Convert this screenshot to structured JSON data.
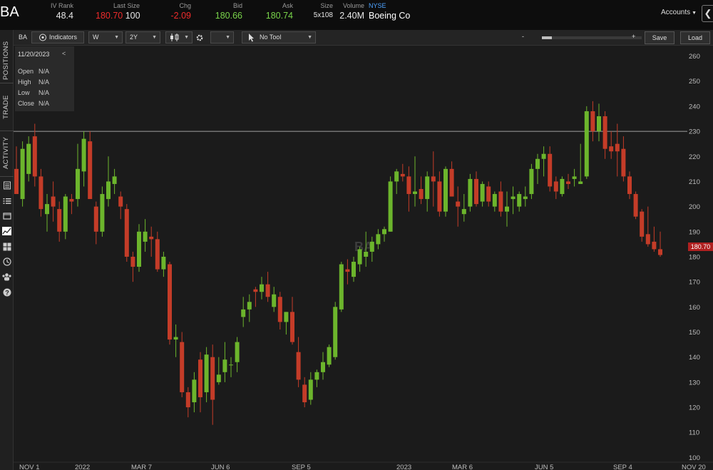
{
  "header": {
    "symbol": "BA",
    "iv_rank": {
      "label": "IV Rank",
      "value": "48.4"
    },
    "last_size": {
      "label": "Last Size",
      "last": "180.70",
      "size": "100"
    },
    "chg": {
      "label": "Chg",
      "value": "-2.09"
    },
    "bid": {
      "label": "Bid",
      "value": "180.66"
    },
    "ask": {
      "label": "Ask",
      "value": "180.74"
    },
    "size": {
      "label": "Size",
      "value": "5x108"
    },
    "volume": {
      "label": "Volume",
      "value": "2.40M"
    },
    "exchange": "NYSE",
    "company": "Boeing Co",
    "accounts_label": "Accounts",
    "back_glyph": "❮"
  },
  "rail": {
    "tabs": [
      "POSITIONS",
      "TRADE",
      "ACTIVITY"
    ],
    "icons": [
      "notes-icon",
      "list-icon",
      "window-icon",
      "chart-icon",
      "grid-icon",
      "clock-icon",
      "community-icon",
      "help-icon"
    ]
  },
  "toolbar": {
    "symbol": "BA",
    "indicators": "Indicators",
    "interval": "W",
    "range": "2Y",
    "tool": "No Tool",
    "zoom_minus": "-",
    "zoom_plus": "+",
    "zoom_level": 0.1,
    "save": "Save",
    "load": "Load"
  },
  "infobox": {
    "date": "11/20/2023",
    "collapse": "<",
    "rows": [
      {
        "k": "Open",
        "v": "N/A"
      },
      {
        "k": "High",
        "v": "N/A"
      },
      {
        "k": "Low",
        "v": "N/A"
      },
      {
        "k": "Close",
        "v": "N/A"
      }
    ]
  },
  "watermark": "BA",
  "last_price_tag": "180.70",
  "chart_data": {
    "type": "candlestick",
    "symbol": "BA",
    "interval": "W",
    "range": "2Y",
    "ylim": [
      95,
      263
    ],
    "y_ticks": [
      100,
      110,
      120,
      130,
      140,
      150,
      160,
      170,
      180,
      190,
      200,
      210,
      220,
      230,
      240,
      250,
      260
    ],
    "x_ticks": [
      "NOV 1",
      "2022",
      "MAR 7",
      "JUN 6",
      "SEP 5",
      "2023",
      "MAR 6",
      "JUN 5",
      "SEP 4",
      "NOV 20"
    ],
    "horizontal_line": 230,
    "last_price": 180.7,
    "colors": {
      "up": "#6cb52c",
      "down": "#c43c28",
      "hline": "#c8c8c8"
    },
    "candles": [
      {
        "o": 215,
        "h": 224,
        "l": 205,
        "c": 205
      },
      {
        "o": 203,
        "h": 226,
        "l": 200,
        "c": 223
      },
      {
        "o": 213,
        "h": 228,
        "l": 210,
        "c": 225
      },
      {
        "o": 228,
        "h": 233,
        "l": 208,
        "c": 212
      },
      {
        "o": 212,
        "h": 215,
        "l": 196,
        "c": 199
      },
      {
        "o": 197,
        "h": 205,
        "l": 190,
        "c": 201
      },
      {
        "o": 204,
        "h": 210,
        "l": 194,
        "c": 200
      },
      {
        "o": 199,
        "h": 202,
        "l": 186,
        "c": 190
      },
      {
        "o": 190,
        "h": 205,
        "l": 187,
        "c": 204
      },
      {
        "o": 203,
        "h": 205,
        "l": 197,
        "c": 202
      },
      {
        "o": 203,
        "h": 225,
        "l": 200,
        "c": 215
      },
      {
        "o": 214,
        "h": 230,
        "l": 208,
        "c": 227
      },
      {
        "o": 226,
        "h": 230,
        "l": 205,
        "c": 203
      },
      {
        "o": 200,
        "h": 202,
        "l": 185,
        "c": 190
      },
      {
        "o": 190,
        "h": 208,
        "l": 188,
        "c": 205
      },
      {
        "o": 203,
        "h": 220,
        "l": 200,
        "c": 210
      },
      {
        "o": 209,
        "h": 215,
        "l": 205,
        "c": 212
      },
      {
        "o": 204,
        "h": 206,
        "l": 195,
        "c": 200
      },
      {
        "o": 199,
        "h": 201,
        "l": 178,
        "c": 180
      },
      {
        "o": 180,
        "h": 182,
        "l": 170,
        "c": 176
      },
      {
        "o": 176,
        "h": 193,
        "l": 174,
        "c": 190
      },
      {
        "o": 186,
        "h": 195,
        "l": 182,
        "c": 190
      },
      {
        "o": 188,
        "h": 192,
        "l": 180,
        "c": 187
      },
      {
        "o": 187,
        "h": 190,
        "l": 174,
        "c": 175
      },
      {
        "o": 175,
        "h": 182,
        "l": 172,
        "c": 180
      },
      {
        "o": 177,
        "h": 178,
        "l": 145,
        "c": 147
      },
      {
        "o": 147,
        "h": 153,
        "l": 140,
        "c": 148
      },
      {
        "o": 146,
        "h": 150,
        "l": 124,
        "c": 126
      },
      {
        "o": 126,
        "h": 128,
        "l": 116,
        "c": 120
      },
      {
        "o": 122,
        "h": 134,
        "l": 118,
        "c": 131
      },
      {
        "o": 139,
        "h": 142,
        "l": 118,
        "c": 124
      },
      {
        "o": 126,
        "h": 144,
        "l": 122,
        "c": 141
      },
      {
        "o": 140,
        "h": 145,
        "l": 113,
        "c": 123
      },
      {
        "o": 130,
        "h": 140,
        "l": 129,
        "c": 133
      },
      {
        "o": 134,
        "h": 146,
        "l": 130,
        "c": 139
      },
      {
        "o": 137,
        "h": 140,
        "l": 132,
        "c": 137
      },
      {
        "o": 138,
        "h": 148,
        "l": 134,
        "c": 146
      },
      {
        "o": 156,
        "h": 164,
        "l": 152,
        "c": 159
      },
      {
        "o": 159,
        "h": 165,
        "l": 154,
        "c": 162
      },
      {
        "o": 167,
        "h": 168,
        "l": 160,
        "c": 166
      },
      {
        "o": 166,
        "h": 172,
        "l": 163,
        "c": 169
      },
      {
        "o": 169,
        "h": 174,
        "l": 162,
        "c": 164
      },
      {
        "o": 160,
        "h": 168,
        "l": 158,
        "c": 165
      },
      {
        "o": 164,
        "h": 166,
        "l": 151,
        "c": 154
      },
      {
        "o": 154,
        "h": 158,
        "l": 149,
        "c": 158
      },
      {
        "o": 158,
        "h": 164,
        "l": 145,
        "c": 146
      },
      {
        "o": 142,
        "h": 148,
        "l": 128,
        "c": 131
      },
      {
        "o": 129,
        "h": 132,
        "l": 120,
        "c": 122
      },
      {
        "o": 123,
        "h": 134,
        "l": 121,
        "c": 131
      },
      {
        "o": 131,
        "h": 135,
        "l": 128,
        "c": 134
      },
      {
        "o": 134,
        "h": 142,
        "l": 131,
        "c": 138
      },
      {
        "o": 137,
        "h": 145,
        "l": 136,
        "c": 144
      },
      {
        "o": 140,
        "h": 162,
        "l": 139,
        "c": 160
      },
      {
        "o": 159,
        "h": 178,
        "l": 158,
        "c": 177
      },
      {
        "o": 175,
        "h": 179,
        "l": 169,
        "c": 174
      },
      {
        "o": 172,
        "h": 180,
        "l": 170,
        "c": 178
      },
      {
        "o": 177,
        "h": 184,
        "l": 174,
        "c": 183
      },
      {
        "o": 180,
        "h": 190,
        "l": 176,
        "c": 182
      },
      {
        "o": 182,
        "h": 188,
        "l": 178,
        "c": 186
      },
      {
        "o": 185,
        "h": 191,
        "l": 183,
        "c": 189
      },
      {
        "o": 189,
        "h": 192,
        "l": 186,
        "c": 191
      },
      {
        "o": 190,
        "h": 212,
        "l": 190,
        "c": 210
      },
      {
        "o": 210,
        "h": 215,
        "l": 205,
        "c": 214
      },
      {
        "o": 213,
        "h": 217,
        "l": 210,
        "c": 212
      },
      {
        "o": 212,
        "h": 216,
        "l": 198,
        "c": 205
      },
      {
        "o": 205,
        "h": 220,
        "l": 200,
        "c": 206
      },
      {
        "o": 207,
        "h": 212,
        "l": 201,
        "c": 203
      },
      {
        "o": 203,
        "h": 214,
        "l": 198,
        "c": 212
      },
      {
        "o": 212,
        "h": 222,
        "l": 200,
        "c": 210
      },
      {
        "o": 210,
        "h": 214,
        "l": 196,
        "c": 198
      },
      {
        "o": 198,
        "h": 216,
        "l": 196,
        "c": 215
      },
      {
        "o": 215,
        "h": 218,
        "l": 204,
        "c": 204
      },
      {
        "o": 202,
        "h": 208,
        "l": 192,
        "c": 200
      },
      {
        "o": 197,
        "h": 205,
        "l": 194,
        "c": 199
      },
      {
        "o": 200,
        "h": 213,
        "l": 198,
        "c": 211
      },
      {
        "o": 211,
        "h": 214,
        "l": 200,
        "c": 201
      },
      {
        "o": 202,
        "h": 210,
        "l": 200,
        "c": 209
      },
      {
        "o": 208,
        "h": 210,
        "l": 200,
        "c": 202
      },
      {
        "o": 200,
        "h": 206,
        "l": 198,
        "c": 205
      },
      {
        "o": 206,
        "h": 210,
        "l": 196,
        "c": 198
      },
      {
        "o": 198,
        "h": 206,
        "l": 192,
        "c": 200
      },
      {
        "o": 203,
        "h": 208,
        "l": 197,
        "c": 204
      },
      {
        "o": 200,
        "h": 206,
        "l": 198,
        "c": 205
      },
      {
        "o": 203,
        "h": 208,
        "l": 200,
        "c": 204
      },
      {
        "o": 205,
        "h": 217,
        "l": 203,
        "c": 215
      },
      {
        "o": 215,
        "h": 221,
        "l": 209,
        "c": 219
      },
      {
        "o": 219,
        "h": 224,
        "l": 212,
        "c": 221
      },
      {
        "o": 221,
        "h": 224,
        "l": 206,
        "c": 208
      },
      {
        "o": 210,
        "h": 212,
        "l": 203,
        "c": 206
      },
      {
        "o": 205,
        "h": 212,
        "l": 204,
        "c": 211
      },
      {
        "o": 210,
        "h": 213,
        "l": 207,
        "c": 209
      },
      {
        "o": 211,
        "h": 215,
        "l": 208,
        "c": 212
      },
      {
        "o": 209,
        "h": 225,
        "l": 209,
        "c": 210
      },
      {
        "o": 212,
        "h": 240,
        "l": 211,
        "c": 238
      },
      {
        "o": 238,
        "h": 242,
        "l": 226,
        "c": 230
      },
      {
        "o": 230,
        "h": 241,
        "l": 226,
        "c": 236
      },
      {
        "o": 236,
        "h": 238,
        "l": 219,
        "c": 223
      },
      {
        "o": 224,
        "h": 230,
        "l": 219,
        "c": 222
      },
      {
        "o": 225,
        "h": 233,
        "l": 212,
        "c": 222
      },
      {
        "o": 223,
        "h": 228,
        "l": 210,
        "c": 212
      },
      {
        "o": 212,
        "h": 214,
        "l": 203,
        "c": 205
      },
      {
        "o": 205,
        "h": 206,
        "l": 195,
        "c": 196
      },
      {
        "o": 198,
        "h": 199,
        "l": 186,
        "c": 188
      },
      {
        "o": 189,
        "h": 200,
        "l": 184,
        "c": 185
      },
      {
        "o": 186,
        "h": 192,
        "l": 182,
        "c": 183
      },
      {
        "o": 183,
        "h": 190,
        "l": 180,
        "c": 180.7
      }
    ]
  }
}
